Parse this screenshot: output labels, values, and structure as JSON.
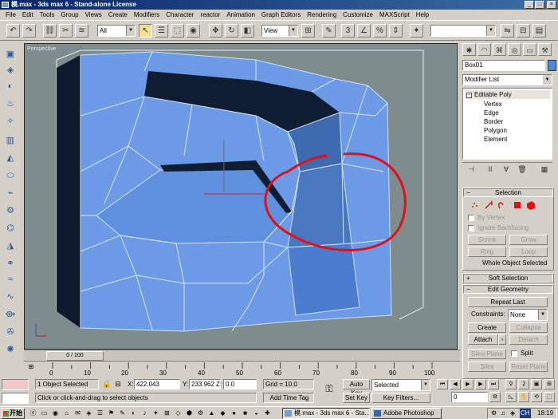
{
  "window": {
    "title": "模.max - 3ds max 6 - Stand-alone License",
    "min_label": "_",
    "max_label": "□",
    "close_label": "×"
  },
  "menu": [
    "File",
    "Edit",
    "Tools",
    "Group",
    "Views",
    "Create",
    "Modifiers",
    "Character",
    "reactor",
    "Animation",
    "Graph Editors",
    "Rendering",
    "Customize",
    "MAXScript",
    "Help"
  ],
  "toolbar": {
    "selection_filter": "All",
    "ref_coord": "View",
    "named_sel": ""
  },
  "viewport": {
    "label": "Perspective",
    "bg_color": "#7f8c8d",
    "mesh_color": "#6d9ae6",
    "annotation_color": "#e0101a"
  },
  "panel": {
    "object_name": "Box01",
    "modifier_list": "Modifier List",
    "stack": {
      "base": "Editable Poly",
      "subs": [
        "Vertex",
        "Edge",
        "Border",
        "Polygon",
        "Element"
      ]
    },
    "selection": {
      "title": "Selection",
      "by_vertex": "By Vertex",
      "ignore_backfacing": "Ignore Backfacing",
      "shrink": "Shrink",
      "grow": "Grow",
      "ring": "Ring",
      "loop": "Loop",
      "status": "Whole Object Selected"
    },
    "soft_selection": "Soft Selection",
    "edit_geometry": {
      "title": "Edit Geometry",
      "repeat_last": "Repeat Last",
      "constraints_label": "Constraints:",
      "constraints_value": "None",
      "create": "Create",
      "collapse": "Collapse",
      "attach": "Attach",
      "detach": "Detach",
      "slice_plane": "Slice Plane",
      "split": "Split",
      "slice": "Slice",
      "reset_plane": "Reset Plane"
    }
  },
  "timeline": {
    "slider_label": "0 / 100",
    "ticks": [
      "0",
      "10",
      "20",
      "30",
      "40",
      "50",
      "60",
      "70",
      "80",
      "90",
      "100"
    ]
  },
  "status": {
    "selection": "1 Object Selected",
    "prompt": "Click or click-and-drag to select objects",
    "x_label": "X:",
    "x_value": "422.043",
    "y_label": "Y:",
    "y_value": "233.962",
    "z_label": "Z:",
    "z_value": "0.0",
    "grid": "Grid = 10.0",
    "add_time_tag": "Add Time Tag",
    "auto_key": "Auto Key",
    "auto_key_value": "Selected",
    "set_key": "Set Key",
    "key_filters": "Key Filters...",
    "frame": "0"
  },
  "taskbar": {
    "start": "开始",
    "tasks": [
      "模.max - 3ds max 6 - Sta...",
      "Adobe Photoshop"
    ],
    "tray_label": "CH",
    "clock": "18:19"
  }
}
